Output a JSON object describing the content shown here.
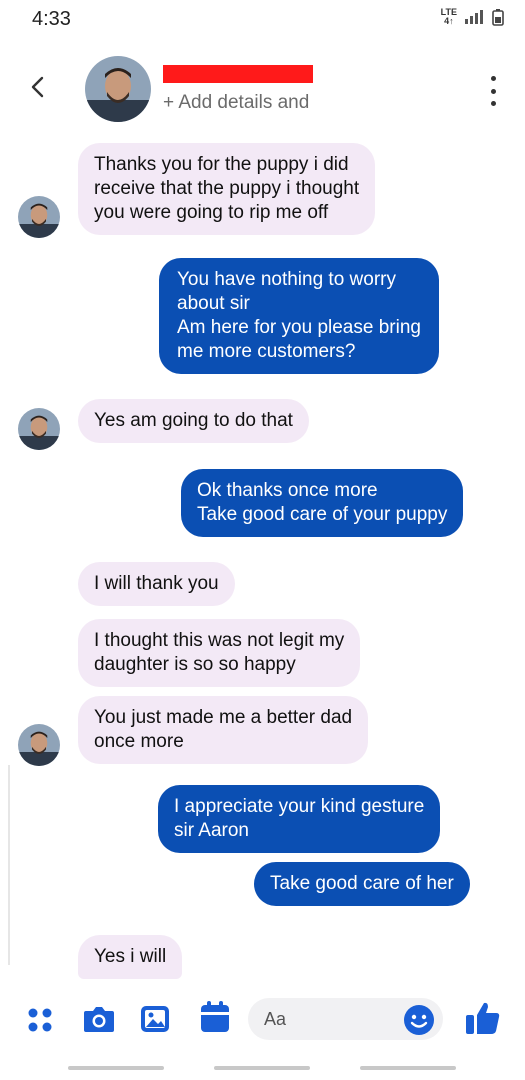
{
  "status": {
    "time": "4:33",
    "network": "LTE"
  },
  "header": {
    "add_details": "+ Add details and"
  },
  "messages": [
    {
      "dir": "in",
      "lines": [
        "Thanks you for the puppy i did",
        "receive that the puppy i thought",
        "you were going to rip me off"
      ]
    },
    {
      "dir": "out",
      "lines": [
        "You have nothing to worry",
        "about sir",
        "Am here for you please bring",
        "me more customers?"
      ]
    },
    {
      "dir": "in",
      "lines": [
        "Yes am going to do that"
      ]
    },
    {
      "dir": "out",
      "lines": [
        "Ok thanks once more",
        "Take good care of your puppy"
      ]
    },
    {
      "dir": "in",
      "lines": [
        "I will thank you"
      ]
    },
    {
      "dir": "in",
      "lines": [
        "I thought this was not legit my",
        "daughter is so so happy"
      ]
    },
    {
      "dir": "in",
      "lines": [
        "You just made me a better dad",
        "once more"
      ]
    },
    {
      "dir": "out",
      "lines": [
        "I appreciate your kind gesture",
        "sir Aaron"
      ]
    },
    {
      "dir": "out",
      "lines": [
        "Take good care of her"
      ]
    },
    {
      "dir": "in",
      "lines": [
        "Yes  i will"
      ]
    }
  ],
  "composer": {
    "placeholder": "Aa"
  },
  "colors": {
    "outgoing_bubble": "#0b4fb3",
    "incoming_bubble": "#f3e9f6",
    "accent": "#1a5fd6",
    "redaction": "#ff1a1a"
  }
}
